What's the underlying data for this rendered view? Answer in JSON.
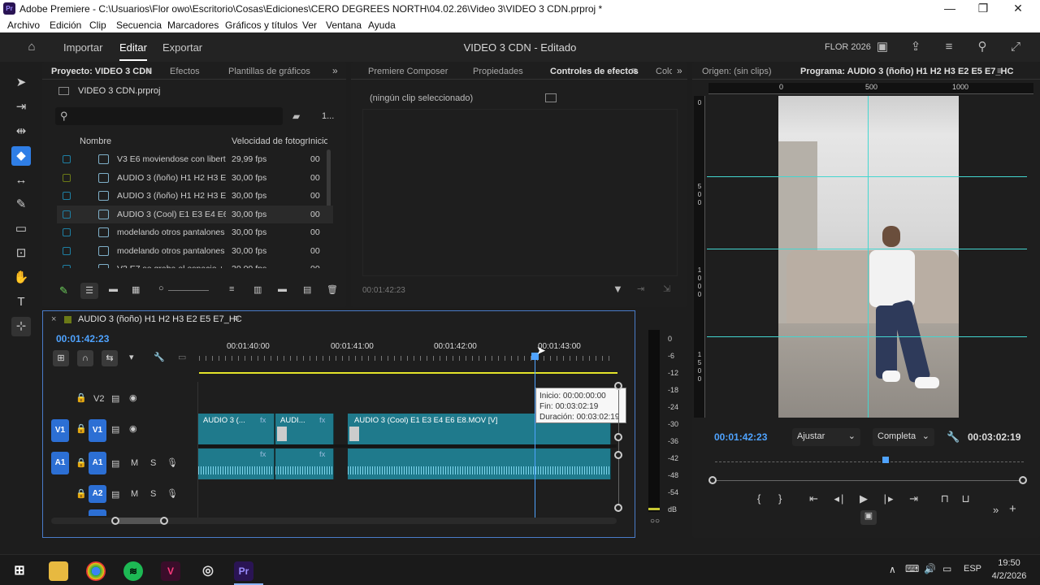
{
  "window": {
    "title": "Adobe Premiere - C:\\Usuarios\\Flor owo\\Escritorio\\Cosas\\Ediciones\\CERO DEGREES NORTH\\04.02.26\\Video 3\\VIDEO 3 CDN.prproj *",
    "logo": "Pr"
  },
  "menu": [
    "Archivo",
    "Edición",
    "Clip",
    "Secuencia",
    "Marcadores",
    "Gráficos y títulos",
    "Ver",
    "Ventana",
    "Ayuda"
  ],
  "header": {
    "workspaces": [
      "Importar",
      "Editar",
      "Exportar"
    ],
    "project_title": "VIDEO 3 CDN - Editado",
    "user": "FLOR 2026"
  },
  "project_panel": {
    "tabs": [
      "Proyecto: VIDEO 3 CDN",
      "Efectos",
      "Plantillas de gráficos"
    ],
    "file": "VIDEO 3 CDN.prproj",
    "count": "1...",
    "search_placeholder": "",
    "columns": [
      "Nombre",
      "Velocidad de fotogr",
      "Inicio"
    ],
    "items": [
      {
        "name": "V3 E6 moviendose con libert",
        "fps": "29,99 fps",
        "start": "00",
        "color": "#1e7fa3"
      },
      {
        "name": "AUDIO 3 (ñoño) H1 H2 H3 E",
        "fps": "30,00 fps",
        "start": "00",
        "color": "#6b7a17"
      },
      {
        "name": "AUDIO 3 (ñoño) H1 H2 H3 E",
        "fps": "30,00 fps",
        "start": "00",
        "color": "#1e7fa3"
      },
      {
        "name": "AUDIO 3 (Cool) E1 E3 E4 E6",
        "fps": "30,00 fps",
        "start": "00",
        "color": "#1e7fa3"
      },
      {
        "name": "modelando otros pantalones",
        "fps": "30,00 fps",
        "start": "00",
        "color": "#1e7fa3"
      },
      {
        "name": "modelando otros pantalones",
        "fps": "30,00 fps",
        "start": "00",
        "color": "#1e7fa3"
      },
      {
        "name": "V3 E7 se graba el espacio + d",
        "fps": "30,00 fps",
        "start": "00",
        "color": "#1e7fa3"
      }
    ]
  },
  "effect_panel": {
    "tabs": [
      "Premiere Composer",
      "Propiedades",
      "Controles de efectos",
      "Colo"
    ],
    "no_clip": "(ningún clip seleccionado)",
    "timecode": "00:01:42:23"
  },
  "program_panel": {
    "tabs": [
      "Origen: (sin clips)",
      "Programa: AUDIO 3 (ñoño) H1 H2 H3 E2 E5 E7_HC"
    ],
    "ruler_labels": [
      "0",
      "500",
      "1000"
    ],
    "vruler_labels": [
      "0",
      "5",
      "0",
      "0",
      "1",
      "0",
      "0",
      "0",
      "1",
      "5",
      "0",
      "0"
    ],
    "timecode": "00:01:42:23",
    "fit": "Ajustar",
    "quality": "Completa",
    "duration": "00:03:02:19"
  },
  "timeline": {
    "sequence": "AUDIO 3 (ñoño) H1 H2 H3 E2 E5 E7_HC",
    "timecode": "00:01:42:23",
    "ruler": [
      "00:01:40:00",
      "00:01:41:00",
      "00:01:42:00",
      "00:01:43:00"
    ],
    "tracks": {
      "v2": "V2",
      "v1_src": "V1",
      "v1": "V1",
      "a1_src": "A1",
      "a1": "A1",
      "a2": "A2",
      "m": "M",
      "s": "S"
    },
    "clips": [
      "AUDIO 3 (...",
      "AUDI...",
      "AUDIO 3 (Cool) E1 E3 E4 E6 E8.MOV [V]"
    ],
    "fx": "fx",
    "tooltip": {
      "start": "Inicio: 00:00:00:00",
      "end": "Fin: 00:03:02:19",
      "duration": "Duración: 00:03:02:19"
    }
  },
  "meter": {
    "labels": [
      "0",
      "-6",
      "-12",
      "-18",
      "-24",
      "-30",
      "-36",
      "-42",
      "-48",
      "-54",
      "dB"
    ],
    "solo": "○○"
  },
  "taskbar": {
    "lang": "ESP",
    "time": "19:50",
    "date": "4/2/2026"
  }
}
